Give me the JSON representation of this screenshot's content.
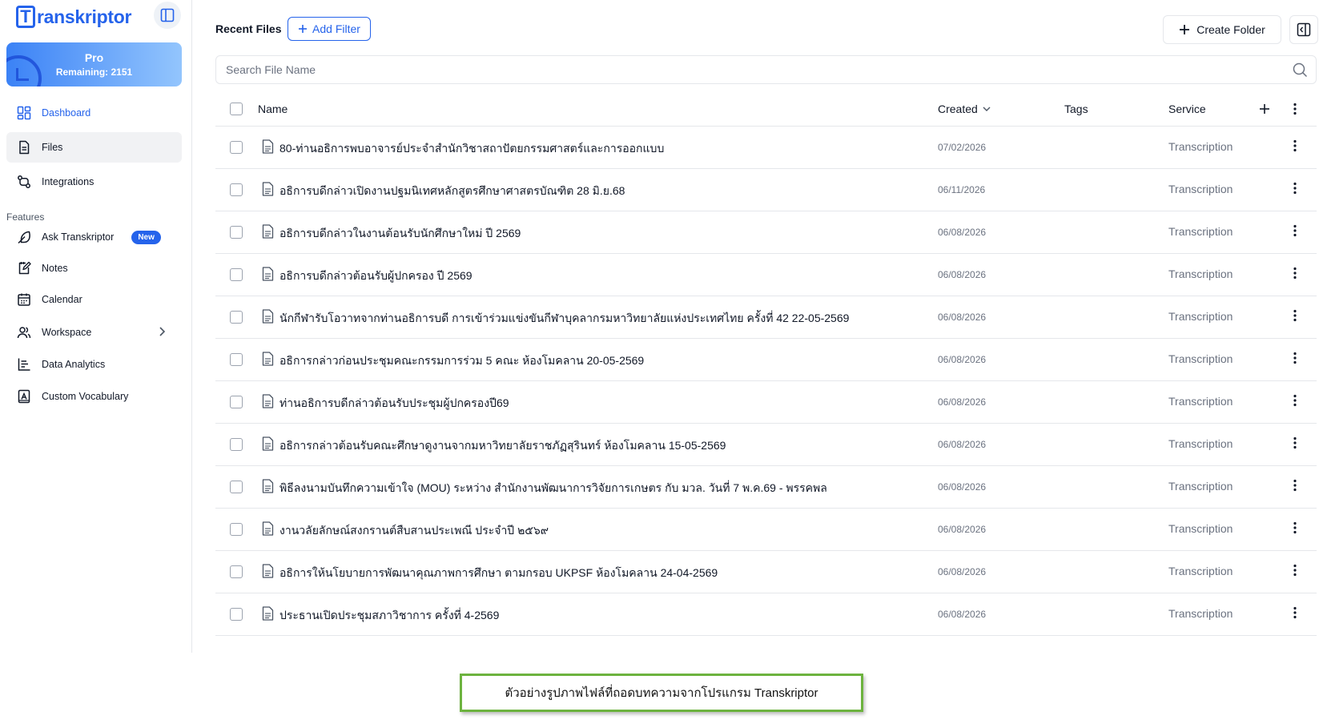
{
  "app": {
    "logo_letter": "T",
    "logo_rest": "ranskriptor"
  },
  "plan": {
    "title": "Pro",
    "remaining": "Remaining: 2151"
  },
  "nav": [
    {
      "label": "Dashboard",
      "icon": "dashboard-icon"
    },
    {
      "label": "Files",
      "icon": "file-icon"
    },
    {
      "label": "Integrations",
      "icon": "integrations-icon"
    }
  ],
  "features_label": "Features",
  "features": [
    {
      "label": "Ask Transkriptor",
      "icon": "feather-icon",
      "badge": "New"
    },
    {
      "label": "Notes",
      "icon": "notes-icon"
    },
    {
      "label": "Calendar",
      "icon": "calendar-icon"
    },
    {
      "label": "Workspace",
      "icon": "users-icon"
    },
    {
      "label": "Data Analytics",
      "icon": "analytics-icon"
    },
    {
      "label": "Custom Vocabulary",
      "icon": "vocabulary-icon"
    }
  ],
  "header": {
    "title": "Recent Files",
    "add_filter": "Add Filter",
    "create_folder": "Create Folder"
  },
  "search": {
    "placeholder": "Search File Name"
  },
  "table": {
    "columns": {
      "name": "Name",
      "created": "Created",
      "tags": "Tags",
      "service": "Service"
    },
    "rows": [
      {
        "name": "80-ท่านอธิการพบอาจารย์ประจำสำนักวิชาสถาปัตยกรรมศาสตร์และการออกแบบ",
        "created": "07/02/2026",
        "service": "Transcription"
      },
      {
        "name": "อธิการบดีกล่าวเปิดงานปฐมนิเทศหลักสูตรศึกษาศาสตรบัณฑิต 28 มิ.ย.68",
        "created": "06/11/2026",
        "service": "Transcription"
      },
      {
        "name": "อธิการบดีกล่าวในงานต้อนรับนักศึกษาใหม่ ปี 2569",
        "created": "06/08/2026",
        "service": "Transcription"
      },
      {
        "name": "อธิการบดีกล่าวต้อนรับผู้ปกครอง ปี 2569",
        "created": "06/08/2026",
        "service": "Transcription"
      },
      {
        "name": "นักกีฬารับโอวาทจากท่านอธิการบดี การเข้าร่วมแข่งขันกีฬาบุคลากรมหาวิทยาลัยแห่งประเทศไทย ครั้งที่ 42 22-05-2569",
        "created": "06/08/2026",
        "service": "Transcription"
      },
      {
        "name": "อธิการกล่าวก่อนประชุมคณะกรรมการร่วม 5 คณะ ห้องโมคลาน 20-05-2569",
        "created": "06/08/2026",
        "service": "Transcription"
      },
      {
        "name": "ท่านอธิการบดีกล่าวต้อนรับประชุมผู้ปกครองปี69",
        "created": "06/08/2026",
        "service": "Transcription"
      },
      {
        "name": "อธิการกล่าวต้อนรับคณะศึกษาดูงานจากมหาวิทยาลัยราชภัฏสุรินทร์ ห้องโมคลาน 15-05-2569",
        "created": "06/08/2026",
        "service": "Transcription"
      },
      {
        "name": "พิธีลงนามบันทึกความเข้าใจ (MOU) ระหว่าง สำนักงานพัฒนาการวิจัยการเกษตร กับ มวล. วันที่ 7 พ.ค.69 - พรรคพล",
        "created": "06/08/2026",
        "service": "Transcription"
      },
      {
        "name": "งานวลัยลักษณ์สงกรานต์สืบสานประเพณี ประจำปี ๒๕๖๙",
        "created": "06/08/2026",
        "service": "Transcription"
      },
      {
        "name": "อธิการให้นโยบายการพัฒนาคุณภาพการศึกษา ตามกรอบ UKPSF ห้องโมคลาน 24-04-2569",
        "created": "06/08/2026",
        "service": "Transcription"
      },
      {
        "name": "ประธานเปิดประชุมสภาวิชาการ ครั้งที่ 4-2569",
        "created": "06/08/2026",
        "service": "Transcription"
      }
    ]
  },
  "caption": "ตัวอย่างรูปภาพไฟล์ที่ถอดบทความจากโปรแกรม Transkriptor",
  "colors": {
    "accent": "#2563eb",
    "caption_border": "#6db33f"
  }
}
